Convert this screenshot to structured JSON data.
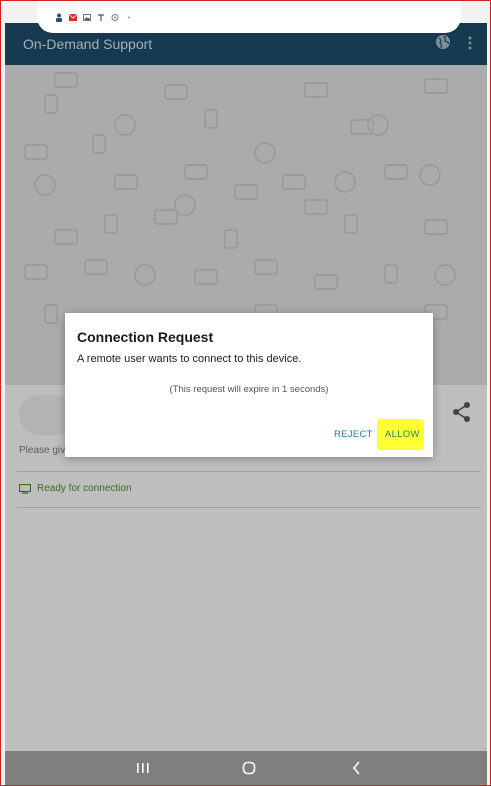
{
  "app": {
    "title": "On-Demand Support"
  },
  "status_bar": {
    "icons": [
      "person-icon",
      "mail-icon",
      "image-icon",
      "signal-icon",
      "settings-icon",
      "dot-icon"
    ]
  },
  "main": {
    "helper_text": "Please give",
    "ready_status": "Ready for connection"
  },
  "dialog": {
    "title": "Connection Request",
    "message": "A remote user wants to connect to this device.",
    "expire_text": "(This request will expire in 1 seconds)",
    "reject_label": "REJECT",
    "allow_label": "ALLOW"
  },
  "nav": {
    "recents_icon": "recents-icon",
    "home_icon": "home-icon",
    "back_icon": "back-icon"
  },
  "colors": {
    "app_bar": "#1d4b66",
    "button_text": "#1d7db5",
    "highlight": "#ffff33",
    "ready_green": "#4a8a2a"
  }
}
